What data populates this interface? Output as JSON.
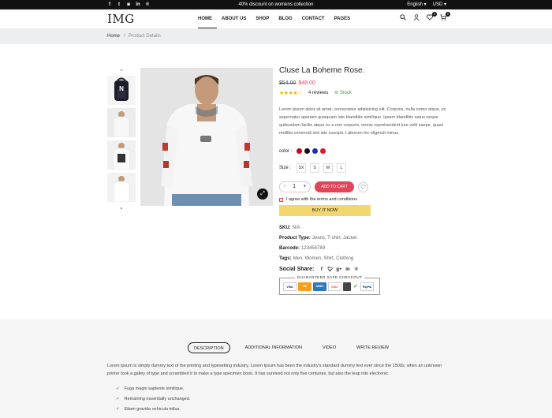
{
  "topbar": {
    "social": [
      "f",
      "t",
      "ig",
      "in",
      "p"
    ],
    "promo": "40% discount on womens collection",
    "language": "English",
    "currency": "USD"
  },
  "header": {
    "logo": "IMG",
    "nav": [
      "HOME",
      "ABOUT US",
      "SHOP",
      "BLOG",
      "CONTACT",
      "PAGES"
    ],
    "wishlist_count": "0",
    "cart_count": "0"
  },
  "breadcrumb": {
    "home": "Home",
    "separator": "/",
    "current": "Product Details"
  },
  "product": {
    "title": "Cluse La Boheme Rose.",
    "old_price": "$54.00",
    "price": "$48.00",
    "rating": 4,
    "reviews": "4 reviews",
    "stock": "In Stock",
    "description": "Lorem ipsum dolor sit amet, consectetur adipisicing elit. Corporis, nulla nemo atque, ex aspernatur aperiam quisquam iste blanditiis similique. Ipsam blanditiis natus neque quibusdam facilis atque ex a non corporis, omnis reprehenderit iure velit saepe, quasi mollitia commodi sint iste suscipit. Laborum hic eligendi minus.",
    "color_label": "color :",
    "colors": [
      "#d0021b",
      "#111111",
      "#1a33b4",
      "#e01818"
    ],
    "size_label": "Size :",
    "sizes": [
      "SX",
      "S",
      "M",
      "L"
    ],
    "qty": "1",
    "minus": "-",
    "plus": "+",
    "add_to_cart": "ADD TO CART",
    "agree": "I agree with the terms and conditions",
    "buy_now": "BUY IT NOW",
    "sku_label": "SKU:",
    "sku": "N/A",
    "type_label": "Product Type:",
    "type": "Jeans, T-shirt, Jacket",
    "barcode_label": "Barcode:",
    "barcode": "123456789",
    "tags_label": "Tags:",
    "tags": "Men, Women, Shirt, Clothing",
    "share_label": "Social Share:",
    "share_icons": [
      "f",
      "t",
      "g+",
      "in",
      "p"
    ],
    "guarantee": "GUARANTEED SAFE CHECKOUT",
    "cards": [
      "VISA",
      "MC",
      "AMEX",
      "DISC",
      "",
      "",
      "PayPal"
    ]
  },
  "tabs": [
    "DESCRIPTION",
    "ADDITIONAL INFORMATION",
    "VIDEO",
    "WRITE REVIEW"
  ],
  "description_tab": {
    "text": "Lorem ipsum is simply dummy text of the printing and typesetting industry. Lorem Ipsum has been the industry's standard dummy text ever since the 1500s, when an unknown printer took a galley of type and scrambled it to make a type specimen book. It has survived not only five centuries, but also the leap into electronic.",
    "bullets": [
      "Fuga magni sapiente similique.",
      "Remaining essentially unchanged.",
      "Etiam gravida vehicula tellus."
    ]
  }
}
